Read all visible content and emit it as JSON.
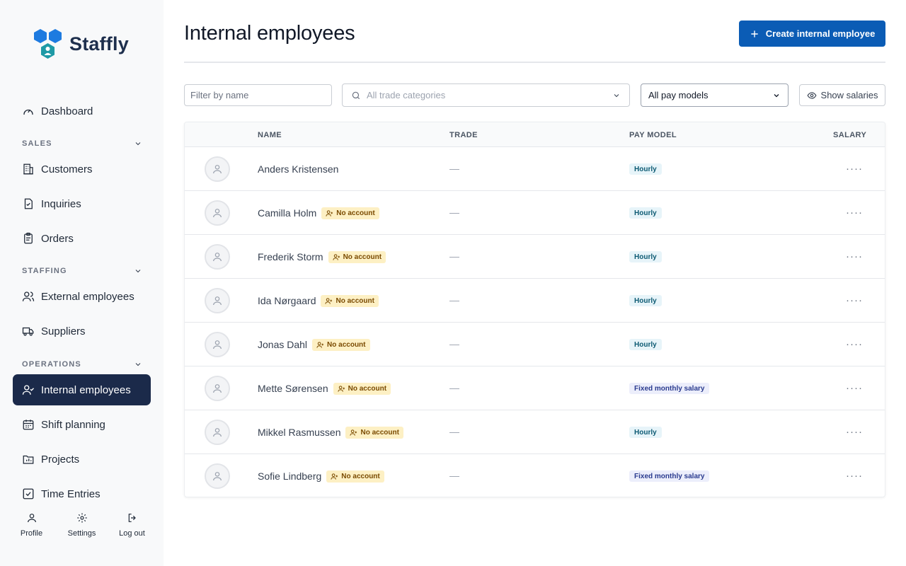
{
  "app": {
    "name": "Staffly"
  },
  "nav": {
    "dashboard": "Dashboard",
    "sections": [
      {
        "label": "SALES",
        "items": [
          "Customers",
          "Inquiries",
          "Orders"
        ]
      },
      {
        "label": "STAFFING",
        "items": [
          "External employees",
          "Suppliers"
        ]
      },
      {
        "label": "OPERATIONS",
        "items": [
          "Internal employees",
          "Shift planning",
          "Projects",
          "Time Entries"
        ]
      }
    ],
    "active": "Internal employees",
    "bottom": [
      "Profile",
      "Settings",
      "Log out"
    ]
  },
  "page": {
    "title": "Internal employees",
    "create_button": "Create internal employee"
  },
  "filters": {
    "name_placeholder": "Filter by name",
    "trade_placeholder": "All trade categories",
    "pay_model_value": "All pay models",
    "show_salaries": "Show salaries"
  },
  "table": {
    "columns": [
      "NAME",
      "TRADE",
      "PAY MODEL",
      "SALARY"
    ],
    "no_account_label": "No account",
    "rows": [
      {
        "name": "Anders Kristensen",
        "no_account": false,
        "trade": "—",
        "pay_model": "Hourly",
        "pay_type": "hourly",
        "salary": "····"
      },
      {
        "name": "Camilla Holm",
        "no_account": true,
        "trade": "—",
        "pay_model": "Hourly",
        "pay_type": "hourly",
        "salary": "····"
      },
      {
        "name": "Frederik Storm",
        "no_account": true,
        "trade": "—",
        "pay_model": "Hourly",
        "pay_type": "hourly",
        "salary": "····"
      },
      {
        "name": "Ida Nørgaard",
        "no_account": true,
        "trade": "—",
        "pay_model": "Hourly",
        "pay_type": "hourly",
        "salary": "····"
      },
      {
        "name": "Jonas Dahl",
        "no_account": true,
        "trade": "—",
        "pay_model": "Hourly",
        "pay_type": "hourly",
        "salary": "····"
      },
      {
        "name": "Mette Sørensen",
        "no_account": true,
        "trade": "—",
        "pay_model": "Fixed monthly salary",
        "pay_type": "fixed",
        "salary": "····"
      },
      {
        "name": "Mikkel Rasmussen",
        "no_account": true,
        "trade": "—",
        "pay_model": "Hourly",
        "pay_type": "hourly",
        "salary": "····"
      },
      {
        "name": "Sofie Lindberg",
        "no_account": true,
        "trade": "—",
        "pay_model": "Fixed monthly salary",
        "pay_type": "fixed",
        "salary": "····"
      }
    ]
  },
  "colors": {
    "brand_dark": "#1b2a4a",
    "primary": "#0b5cb5",
    "logo_blue": "#1e7be0",
    "logo_teal": "#1f9aa6",
    "badge_warning_bg": "#fdf0c4"
  }
}
